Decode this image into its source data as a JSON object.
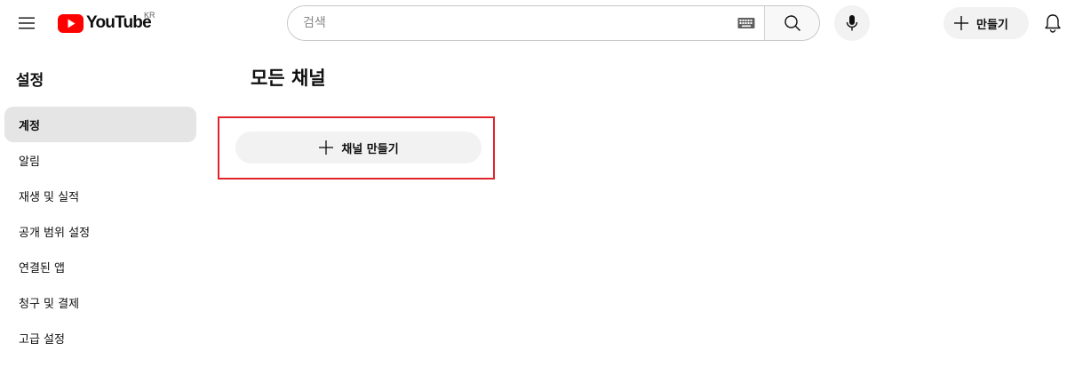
{
  "header": {
    "logo_text": "YouTube",
    "country_code": "KR",
    "search_placeholder": "검색",
    "create_label": "만들기"
  },
  "sidebar": {
    "title": "설정",
    "items": [
      {
        "label": "계정",
        "active": true
      },
      {
        "label": "알림"
      },
      {
        "label": "재생 및 실적"
      },
      {
        "label": "공개 범위 설정"
      },
      {
        "label": "연결된 앱"
      },
      {
        "label": "청구 및 결제"
      },
      {
        "label": "고급 설정"
      }
    ]
  },
  "main": {
    "title": "모든 채널",
    "create_channel_label": "채널 만들기"
  },
  "colors": {
    "brand_red": "#ff0000",
    "highlight": "#e0242b",
    "button_bg": "#f2f2f2"
  }
}
